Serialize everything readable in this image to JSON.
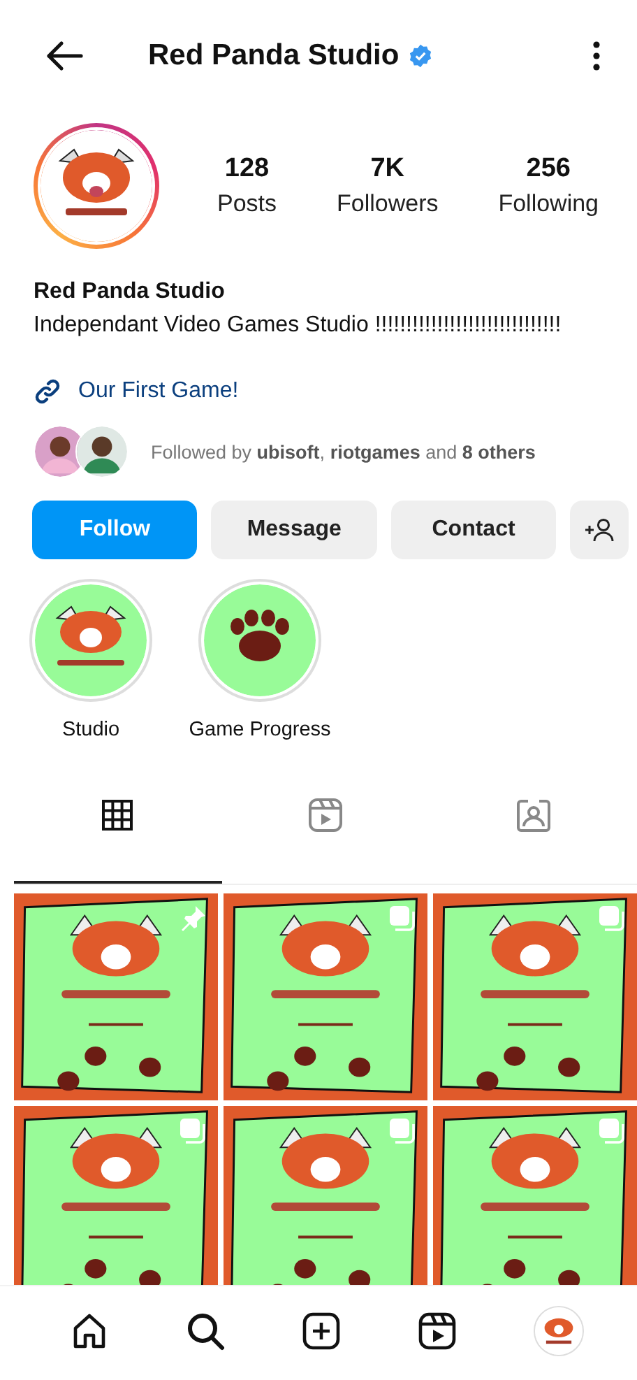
{
  "header": {
    "title": "Red Panda Studio",
    "verified": true
  },
  "stats": [
    {
      "value": "128",
      "label": "Posts"
    },
    {
      "value": "7K",
      "label": "Followers"
    },
    {
      "value": "256",
      "label": "Following"
    }
  ],
  "profile": {
    "name": "Red Panda Studio",
    "bio": "Independant Video Games Studio !!!!!!!!!!!!!!!!!!!!!!!!!!!!!!",
    "link": "Our First Game!",
    "followed_by": "Followed by **ubisoft**, **riotgames** and **8 others**"
  },
  "buttons": [
    {
      "label": "Follow",
      "kind": "primary"
    },
    {
      "label": "Message",
      "kind": "secondary"
    },
    {
      "label": "Contact",
      "kind": "secondary"
    }
  ],
  "highlights": [
    {
      "label": "Studio",
      "kind": "panda"
    },
    {
      "label": "Game Progress",
      "kind": "paw"
    }
  ],
  "tabs": [
    {
      "kind": "grid",
      "selected": true
    },
    {
      "kind": "reels",
      "selected": false
    },
    {
      "kind": "tagged",
      "selected": false
    }
  ],
  "posts": [
    {
      "kind": "pinned"
    },
    {
      "kind": "carousel"
    },
    {
      "kind": "carousel"
    },
    {
      "kind": "carousel"
    },
    {
      "kind": "carousel"
    },
    {
      "kind": "carousel"
    }
  ],
  "nav": [
    {
      "kind": "home"
    },
    {
      "kind": "search"
    },
    {
      "kind": "add"
    },
    {
      "kind": "reels"
    },
    {
      "kind": "profile"
    }
  ]
}
